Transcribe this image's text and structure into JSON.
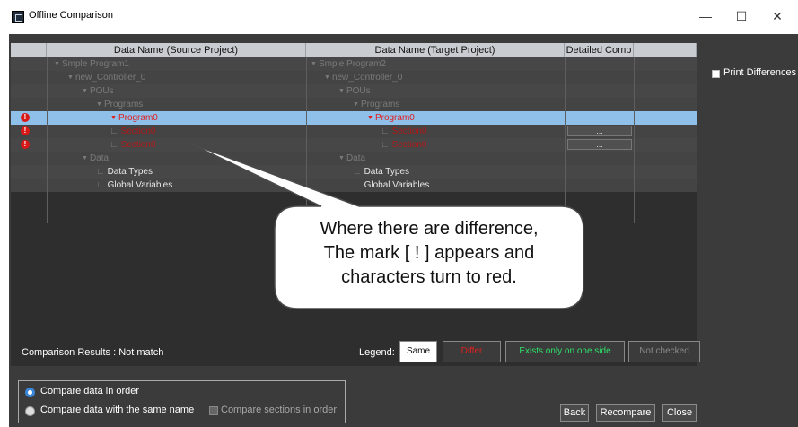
{
  "window": {
    "title": "Offline Comparison",
    "minimize": "—",
    "maximize": "☐",
    "close": "✕"
  },
  "grid": {
    "headers": [
      "Data Name (Source Project)",
      "Data Name (Target Project)",
      "Detailed Comp"
    ],
    "rows": [
      {
        "source": "Smple Program1",
        "target": "Smple Program2",
        "level": 0,
        "tri": true
      },
      {
        "source": "new_Controller_0",
        "target": "new_Controller_0",
        "level": 1,
        "tri": true
      },
      {
        "source": "POUs",
        "target": "POUs",
        "level": 2,
        "tri": true
      },
      {
        "source": "Programs",
        "target": "Programs",
        "level": 3,
        "tri": true
      },
      {
        "source": "Program0",
        "target": "Program0",
        "level": 4,
        "tri": true,
        "diff": true,
        "selected": true
      },
      {
        "source": "Section0",
        "target": "Section0",
        "level": 5,
        "diff": true,
        "detail": "..."
      },
      {
        "source": "Section0",
        "target": "Section0",
        "level": 5,
        "diff": true,
        "detail": "..."
      },
      {
        "source": "Data",
        "target": "Data",
        "level": 2,
        "tri": true
      },
      {
        "source": "Data Types",
        "target": "Data Types",
        "level": 3,
        "white": true
      },
      {
        "source": "Global Variables",
        "target": "Global Variables",
        "level": 3,
        "white": true
      }
    ],
    "diff_mark": "!"
  },
  "options": {
    "print_differences": "Print Differences",
    "results_label": "Comparison Results : Not match",
    "legend_label": "Legend:",
    "legend": {
      "same": "Same",
      "differ": "Differ",
      "exists": "Exists only on one side",
      "not_checked": "Not checked"
    },
    "compare_in_order": "Compare data in order",
    "compare_same_name": "Compare data with the same name",
    "compare_sections": "Compare sections in order"
  },
  "buttons": {
    "back": "Back",
    "recompare": "Recompare",
    "close": "Close"
  },
  "callout": {
    "lines": [
      "Where there are difference,",
      "The mark [ ! ] appears and",
      "characters turn to red."
    ]
  },
  "colors": {
    "diff_red": "#e02020",
    "exists_green": "#2ee06a",
    "selected_row": "#8fc0ea",
    "panel": "#3b3b3b"
  }
}
